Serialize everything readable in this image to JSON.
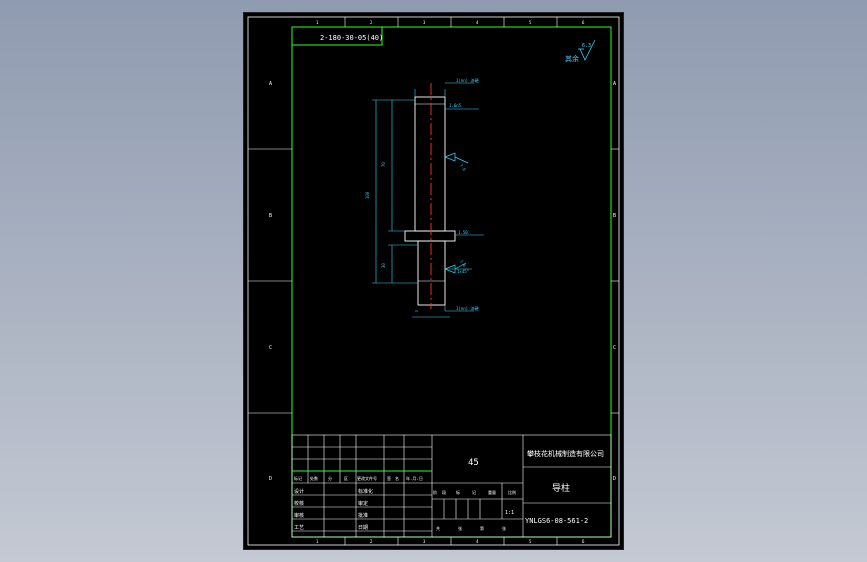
{
  "drawing": {
    "code_box": "2-180-30-05(40)",
    "roughness": {
      "value": "6.3",
      "other": "其余"
    },
    "zone_letters": [
      "A",
      "B",
      "C",
      "D"
    ],
    "zone_numbers": [
      "1",
      "2",
      "3",
      "4",
      "5",
      "6"
    ],
    "dims": {
      "chamfer_top": "1.6n5",
      "overall": "100",
      "upper_len": "70",
      "lower_len": "30",
      "flange_w": "1.50",
      "chamfer_bottom": "1x45°",
      "rough_a": "1.6",
      "rough_b": "1.6",
      "notes_top": "1(nn) 淬硬",
      "notes_bottom": "1(nn) 淬硬"
    }
  },
  "title_block": {
    "material": "45",
    "company": "攀枝花机械制造有限公司",
    "part_name": "导柱",
    "drawing_no": "YNLGS6-08-561-2",
    "rev_row": [
      "标记",
      "处数",
      "分",
      "区",
      "更改文件号",
      "签",
      "名",
      "年.月.日"
    ],
    "rows_left": [
      "设计",
      "校核",
      "审核",
      "工艺"
    ],
    "rows_mid": [
      "标准化",
      "审定",
      "批准",
      "日期"
    ],
    "stage_labels": [
      "阶",
      "段",
      "标",
      "记",
      "重量",
      "比例"
    ],
    "scale": "1:1",
    "sheet_labels": [
      "共",
      "张",
      "第",
      "张"
    ]
  }
}
